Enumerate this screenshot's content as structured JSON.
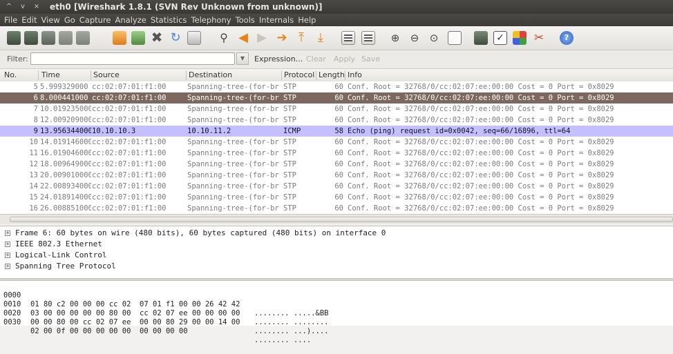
{
  "window": {
    "title": "eth0   [Wireshark 1.8.1  (SVN Rev Unknown from unknown)]",
    "controls": [
      "^",
      "v",
      "×"
    ]
  },
  "menu": [
    "File",
    "Edit",
    "View",
    "Go",
    "Capture",
    "Analyze",
    "Statistics",
    "Telephony",
    "Tools",
    "Internals",
    "Help"
  ],
  "toolbar": {
    "icons": [
      "interface-list-icon",
      "capture-options-icon",
      "start-capture-icon",
      "stop-capture-icon",
      "restart-capture-icon",
      "open-file-icon",
      "save-file-icon",
      "close-file-icon",
      "reload-icon",
      "print-icon",
      "find-packet-icon",
      "go-back-icon",
      "go-forward-icon",
      "go-to-packet-icon",
      "go-first-icon",
      "go-last-icon",
      "colorize-icon",
      "auto-scroll-icon",
      "zoom-in-icon",
      "zoom-out-icon",
      "normal-size-icon",
      "resize-columns-icon",
      "capture-filters-icon",
      "display-filters-icon",
      "coloring-rules-icon",
      "preferences-icon",
      "help-icon"
    ]
  },
  "filter": {
    "label": "Filter:",
    "value": "",
    "expression": "Expression...",
    "clear": "Clear",
    "apply": "Apply",
    "save": "Save"
  },
  "columns": [
    "No.",
    "Time",
    "Source",
    "Destination",
    "Protocol",
    "Length",
    "Info"
  ],
  "packets": [
    {
      "no": "5",
      "time": "5.999329000",
      "src": "cc:02:07:01:f1:00",
      "dst": "Spanning-tree-(for-br",
      "proto": "STP",
      "len": "60",
      "info": "Conf. Root = 32768/0/cc:02:07:ee:00:00   Cost = 0   Port = 0x8029",
      "style": "stp"
    },
    {
      "no": "6",
      "time": "8.000441000",
      "src": "cc:02:07:01:f1:00",
      "dst": "Spanning-tree-(for-br",
      "proto": "STP",
      "len": "60",
      "info": "Conf. Root = 32768/0/cc:02:07:ee:00:00   Cost = 0   Port = 0x8029",
      "style": "selected"
    },
    {
      "no": "7",
      "time": "10.019235000",
      "src": "cc:02:07:01:f1:00",
      "dst": "Spanning-tree-(for-br",
      "proto": "STP",
      "len": "60",
      "info": "Conf. Root = 32768/0/cc:02:07:ee:00:00   Cost = 0   Port = 0x8029",
      "style": "stp"
    },
    {
      "no": "8",
      "time": "12.009209000",
      "src": "cc:02:07:01:f1:00",
      "dst": "Spanning-tree-(for-br",
      "proto": "STP",
      "len": "60",
      "info": "Conf. Root = 32768/0/cc:02:07:ee:00:00   Cost = 0   Port = 0x8029",
      "style": "stp"
    },
    {
      "no": "9",
      "time": "13.956344000",
      "src": "10.10.10.3",
      "dst": "10.10.11.2",
      "proto": "ICMP",
      "len": "58",
      "info": "Echo (ping) request  id=0x0042, seq=66/16896, ttl=64",
      "style": "icmp"
    },
    {
      "no": "10",
      "time": "14.019146000",
      "src": "cc:02:07:01:f1:00",
      "dst": "Spanning-tree-(for-br",
      "proto": "STP",
      "len": "60",
      "info": "Conf. Root = 32768/0/cc:02:07:ee:00:00   Cost = 0   Port = 0x8029",
      "style": "stp"
    },
    {
      "no": "11",
      "time": "16.019046000",
      "src": "cc:02:07:01:f1:00",
      "dst": "Spanning-tree-(for-br",
      "proto": "STP",
      "len": "60",
      "info": "Conf. Root = 32768/0/cc:02:07:ee:00:00   Cost = 0   Port = 0x8029",
      "style": "stp"
    },
    {
      "no": "12",
      "time": "18.009649000",
      "src": "cc:02:07:01:f1:00",
      "dst": "Spanning-tree-(for-br",
      "proto": "STP",
      "len": "60",
      "info": "Conf. Root = 32768/0/cc:02:07:ee:00:00   Cost = 0   Port = 0x8029",
      "style": "stp"
    },
    {
      "no": "13",
      "time": "20.009010000",
      "src": "cc:02:07:01:f1:00",
      "dst": "Spanning-tree-(for-br",
      "proto": "STP",
      "len": "60",
      "info": "Conf. Root = 32768/0/cc:02:07:ee:00:00   Cost = 0   Port = 0x8029",
      "style": "stp"
    },
    {
      "no": "14",
      "time": "22.008934000",
      "src": "cc:02:07:01:f1:00",
      "dst": "Spanning-tree-(for-br",
      "proto": "STP",
      "len": "60",
      "info": "Conf. Root = 32768/0/cc:02:07:ee:00:00   Cost = 0   Port = 0x8029",
      "style": "stp"
    },
    {
      "no": "15",
      "time": "24.018914000",
      "src": "cc:02:07:01:f1:00",
      "dst": "Spanning-tree-(for-br",
      "proto": "STP",
      "len": "60",
      "info": "Conf. Root = 32768/0/cc:02:07:ee:00:00   Cost = 0   Port = 0x8029",
      "style": "stp"
    },
    {
      "no": "16",
      "time": "26.008851000",
      "src": "cc:02:07:01:f1:00",
      "dst": "Spanning-tree-(for-br",
      "proto": "STP",
      "len": "60",
      "info": "Conf. Root = 32768/0/cc:02:07:ee:00:00   Cost = 0   Port = 0x8029",
      "style": "stp"
    }
  ],
  "row_styles": {
    "stp": {
      "bg": "#ffffff",
      "fg": "#7c7c7c"
    },
    "selected": {
      "bg": "#7d6860",
      "fg": "#ffffff"
    },
    "icmp": {
      "bg": "#c4c0ff",
      "fg": "#12122a"
    }
  },
  "details": [
    "Frame 6: 60 bytes on wire (480 bits), 60 bytes captured (480 bits) on interface 0",
    "IEEE 802.3 Ethernet",
    "Logical-Link Control",
    "Spanning Tree Protocol"
  ],
  "hex": [
    {
      "offset": "0000",
      "bytes": "01 80 c2 00 00 00 cc 02  07 01 f1 00 00 26 42 42",
      "ascii": "........ .....&BB"
    },
    {
      "offset": "0010",
      "bytes": "03 00 00 00 00 00 80 00  cc 02 07 ee 00 00 00 00",
      "ascii": "........ ........"
    },
    {
      "offset": "0020",
      "bytes": "00 00 80 00 cc 02 07 ee  00 00 80 29 00 00 14 00",
      "ascii": "........ ...)...."
    },
    {
      "offset": "0030",
      "bytes": "02 00 0f 00 00 00 00 00  00 00 00 00",
      "ascii": "........ ...."
    }
  ]
}
